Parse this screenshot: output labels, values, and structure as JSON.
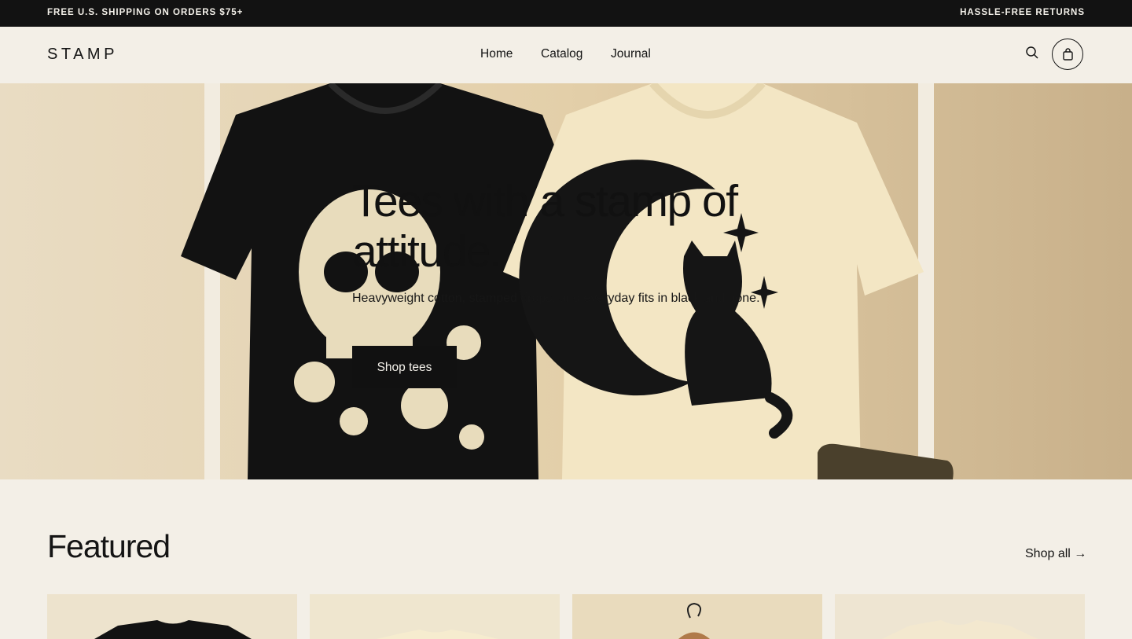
{
  "announcement": {
    "left": "FREE U.S. SHIPPING ON ORDERS $75+",
    "right": "HASSLE-FREE RETURNS"
  },
  "header": {
    "logo": "STAMP",
    "nav": [
      "Home",
      "Catalog",
      "Journal"
    ],
    "icons": {
      "search": "search-icon",
      "cart": "shopping-bag-icon"
    }
  },
  "hero": {
    "title": "Tees with a stamp of attitude.",
    "subtitle": "Heavyweight cotton, stamped drops, and everyday fits in black and bone.",
    "cta": "Shop tees"
  },
  "featured": {
    "title": "Featured",
    "shop_all": "Shop all →"
  },
  "colors": {
    "accent": "#111111",
    "background": "#f3efe7",
    "announcement_bg": "#121212"
  }
}
